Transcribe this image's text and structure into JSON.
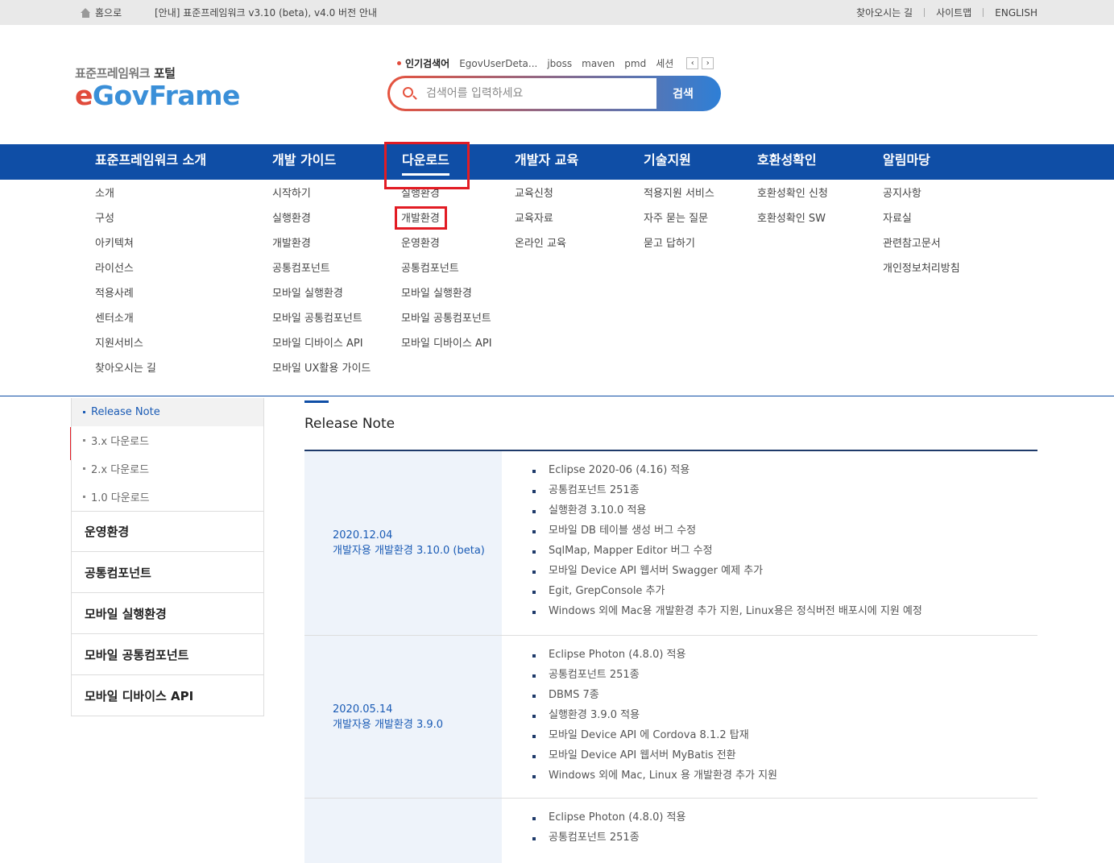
{
  "topbar": {
    "home": "홈으로",
    "notice": "[안내] 표준프레임워크 v3.10 (beta), v4.0 버전 안내",
    "util": [
      "찾아오시는 길",
      "사이트맵",
      "ENGLISH"
    ]
  },
  "logo": {
    "sub_prefix": "표준프레임워크 ",
    "sub_bold": "포털",
    "main_e": "e",
    "main_rest": "GovFrame"
  },
  "popular": {
    "title": "인기검색어",
    "keywords": [
      "EgovUserDeta...",
      "jboss",
      "maven",
      "pmd",
      "세션"
    ],
    "prev": "‹",
    "next": "›"
  },
  "search": {
    "placeholder": "검색어를 입력하세요",
    "button": "검색"
  },
  "gnb": [
    "표준프레임워크 소개",
    "개발 가이드",
    "다운로드",
    "개발자 교육",
    "기술지원",
    "호환성확인",
    "알림마당"
  ],
  "submenu": [
    [
      "소개",
      "구성",
      "아키텍쳐",
      "라이선스",
      "적용사례",
      "센터소개",
      "지원서비스",
      "찾아오시는 길"
    ],
    [
      "시작하기",
      "실행환경",
      "개발환경",
      "공통컴포넌트",
      "모바일 실행환경",
      "모바일 공통컴포넌트",
      "모바일 디바이스 API",
      "모바일 UX활용 가이드"
    ],
    [
      "실행환경",
      "개발환경",
      "운영환경",
      "공통컴포넌트",
      "모바일 실행환경",
      "모바일 공통컴포넌트",
      "모바일 디바이스 API"
    ],
    [
      "교육신청",
      "교육자료",
      "온라인 교육"
    ],
    [
      "적용지원 서비스",
      "자주 묻는 질문",
      "묻고 답하기"
    ],
    [
      "호환성확인 신청",
      "호환성확인 SW"
    ],
    [
      "공지사항",
      "자료실",
      "관련참고문서",
      "개인정보처리방침"
    ]
  ],
  "lnb": {
    "subs": [
      "Release Note",
      "3.x 다운로드",
      "2.x 다운로드",
      "1.0 다운로드"
    ],
    "bigs": [
      "운영환경",
      "공통컴포넌트",
      "모바일 실행환경",
      "모바일 공통컴포넌트",
      "모바일 디바이스 API"
    ]
  },
  "content": {
    "title": "Release Note",
    "rows": [
      {
        "date": "2020.12.04",
        "version": "개발자용 개발환경 3.10.0 (beta)",
        "items": [
          "Eclipse 2020-06 (4.16) 적용",
          "공통컴포넌트 251종",
          "실행환경 3.10.0 적용",
          "모바일 DB 테이블 생성 버그 수정",
          "SqlMap, Mapper Editor 버그 수정",
          "모바일 Device API 웹서버 Swagger 예제 추가",
          "Egit, GrepConsole 추가",
          "Windows 외에 Mac용 개발환경 추가 지원, Linux용은 정식버전 배포시에 지원 예정"
        ]
      },
      {
        "date": "2020.05.14",
        "version": "개발자용 개발환경 3.9.0",
        "items": [
          "Eclipse Photon (4.8.0) 적용",
          "공통컴포넌트 251종",
          "DBMS 7종",
          "실행환경 3.9.0 적용",
          "모바일 Device API 에 Cordova 8.1.2 탑재",
          "모바일 Device API 웹서버 MyBatis 전환",
          "Windows 외에 Mac, Linux 용 개발환경 추가 지원"
        ]
      },
      {
        "date": "",
        "version": "",
        "items": [
          "Eclipse Photon (4.8.0) 적용",
          "공통컴포넌트 251종"
        ]
      }
    ]
  }
}
